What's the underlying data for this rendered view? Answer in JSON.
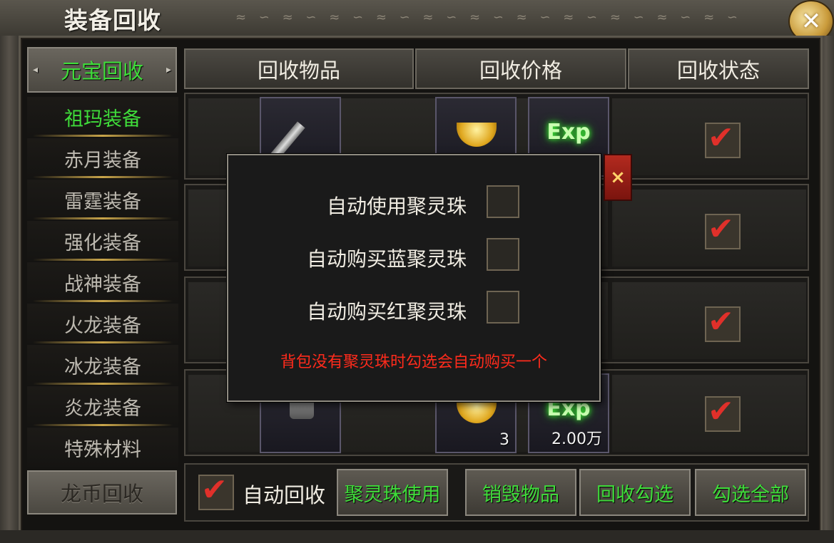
{
  "window": {
    "title": "装备回收",
    "close_icon": "close-icon"
  },
  "sidebar": {
    "top_button": "元宝回收",
    "items": [
      {
        "label": "祖玛装备",
        "active": true
      },
      {
        "label": "赤月装备",
        "active": false
      },
      {
        "label": "雷霆装备",
        "active": false
      },
      {
        "label": "强化装备",
        "active": false
      },
      {
        "label": "战神装备",
        "active": false
      },
      {
        "label": "火龙装备",
        "active": false
      },
      {
        "label": "冰龙装备",
        "active": false
      },
      {
        "label": "炎龙装备",
        "active": false
      },
      {
        "label": "特殊材料",
        "active": false
      }
    ],
    "bottom_button": "龙币回收"
  },
  "table": {
    "headers": [
      "回收物品",
      "回收价格",
      "回收状态"
    ],
    "rows": [
      {
        "item": "sword",
        "price_gold_count": "",
        "price_exp": "",
        "checked": true
      },
      {
        "item": "",
        "price_gold_count": "",
        "price_exp": "",
        "checked": true
      },
      {
        "item": "",
        "price_gold_count": "",
        "price_exp": "",
        "checked": true
      },
      {
        "item": "helmet",
        "price_gold_count": "3",
        "price_exp": "2.00万",
        "checked": true
      }
    ]
  },
  "bottom": {
    "auto_recycle_label": "自动回收",
    "auto_recycle_checked": true,
    "buttons": [
      "聚灵珠使用",
      "销毁物品",
      "回收勾选",
      "勾选全部"
    ]
  },
  "popup": {
    "options": [
      {
        "label": "自动使用聚灵珠",
        "checked": false
      },
      {
        "label": "自动购买蓝聚灵珠",
        "checked": false
      },
      {
        "label": "自动购买红聚灵珠",
        "checked": false
      }
    ],
    "hint": "背包没有聚灵珠时勾选会自动购买一个",
    "close_glyph": "×"
  },
  "icons": {
    "exp_text": "Exp",
    "checkmark": "✔",
    "close_glyph": "✕"
  }
}
